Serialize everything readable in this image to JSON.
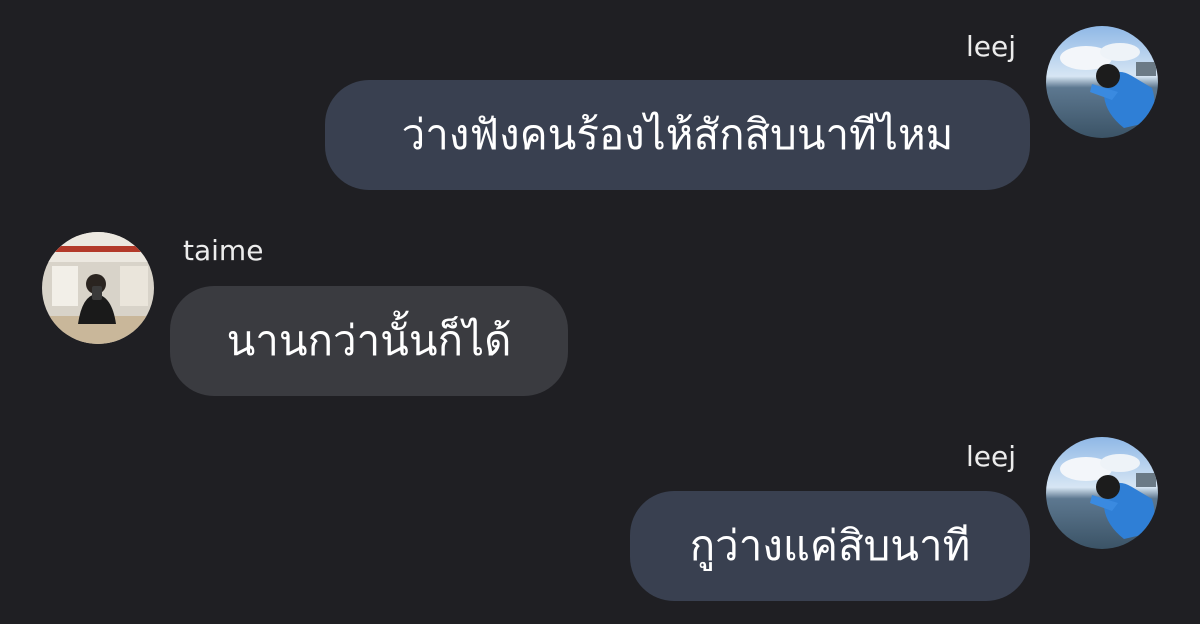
{
  "messages": [
    {
      "sender": "leej",
      "text": "ว่างฟังคนร้องไห้สักสิบนาทีไหม",
      "side": "right"
    },
    {
      "sender": "taime",
      "text": "นานกว่านั้นก็ได้",
      "side": "left"
    },
    {
      "sender": "leej",
      "text": "กูว่างแค่สิบนาที",
      "side": "right"
    }
  ],
  "colors": {
    "background": "#1f1f23",
    "outgoing_bubble": "#394050",
    "incoming_bubble": "#3a3b40",
    "text": "#ffffff"
  }
}
